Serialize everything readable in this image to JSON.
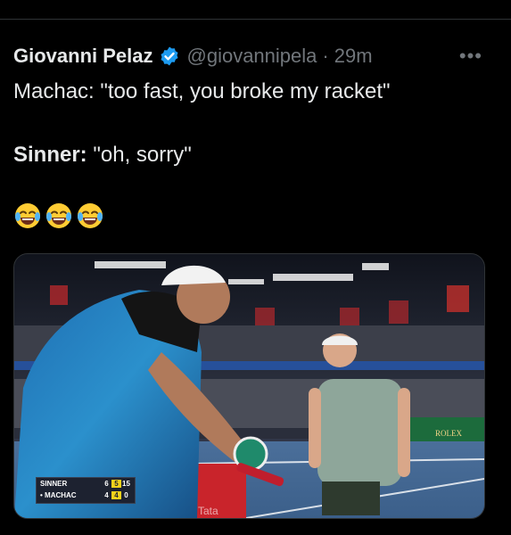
{
  "author": {
    "name": "Giovanni Pelaz",
    "handle": "@giovannipela",
    "separator": "·",
    "time": "29m",
    "verified_icon": "verified-badge-icon"
  },
  "more_label": "•••",
  "tweet": {
    "line1": "Machac: \"too fast, you broke my racket\"",
    "line2_speaker": "Sinner:",
    "line2_text": " \"oh, sorry\"",
    "emojis": [
      "face-with-tears-of-joy-icon",
      "face-with-tears-of-joy-icon",
      "face-with-tears-of-joy-icon"
    ]
  },
  "media": {
    "description_icon": "tennis-photo",
    "scoreboard": {
      "rows": [
        {
          "player": "SINNER",
          "s1": "6",
          "s2": "5",
          "s3": "15"
        },
        {
          "player": "• MACHAC",
          "s1": "4",
          "s2": "4",
          "s3": "0"
        }
      ]
    },
    "banner_brand": "ROLEX",
    "banner_small": "Tata"
  },
  "colors": {
    "background": "#000000",
    "text": "#e7e9ea",
    "muted": "#71767b",
    "verified": "#1d9bf0"
  }
}
